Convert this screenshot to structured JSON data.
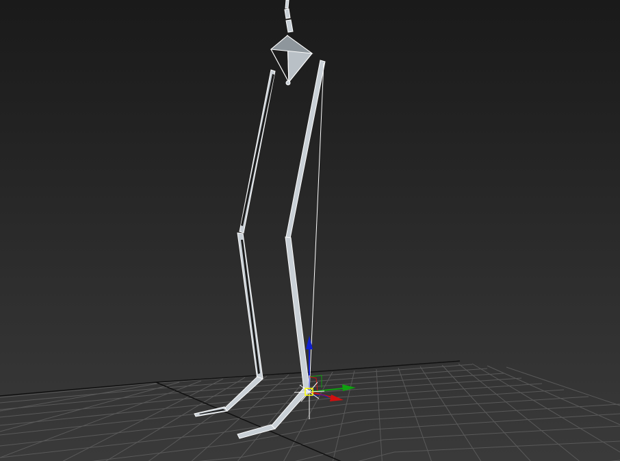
{
  "viewport": {
    "background_top": "#1a1a1a",
    "background_bottom": "#3a3a3a",
    "grid_color": "#5a5a5a",
    "grid_axis_color": "#111111",
    "bone_fill": "#c9d0d6",
    "bone_edge": "#ffffff",
    "bone_shadow": "#1c1c1c",
    "gizmo": {
      "x_axis_color": "#d01010",
      "y_axis_color": "#10a010",
      "z_axis_color": "#1020d0",
      "pivot_color": "#ffff00"
    }
  }
}
